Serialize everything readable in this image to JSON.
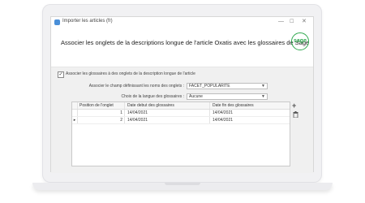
{
  "window": {
    "title": "Importer les articles (fr)",
    "min_icon": "minimize-icon",
    "max_icon": "maximize-icon",
    "close_icon": "close-icon"
  },
  "header": {
    "title": "Associer les onglets de la descriptions longue de l'article Oxatis avec les glossaires de Sage",
    "logo_text": "sage",
    "logo_color": "#2fa84f"
  },
  "form": {
    "associate_checkbox_label": "Associer les glossaires à des onglets de la description longue de l'article",
    "associate_checked": true,
    "field_label": "Associer le champ définissant les noms des onglets :",
    "field_value": "FACET_POPULARITE",
    "language_label": "Choix de la langue des glossaires :",
    "language_value": "Aucune"
  },
  "grid": {
    "columns": [
      "Position de l'onglet",
      "Date debut des glossaires",
      "Date fin des glossaires"
    ],
    "rows": [
      {
        "marker": "",
        "position": "1",
        "start": "14/04/2021",
        "end": "14/04/2021"
      },
      {
        "marker": "▸",
        "position": "2",
        "start": "14/04/2021",
        "end": "14/04/2021"
      }
    ]
  },
  "actions": {
    "add_icon": "plus-icon",
    "delete_icon": "trash-icon"
  }
}
